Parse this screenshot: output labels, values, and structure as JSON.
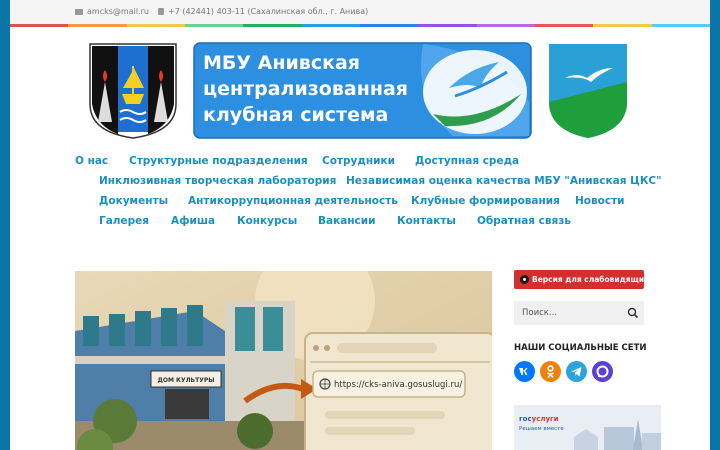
{
  "topbar": {
    "email": "amcks@mail.ru",
    "phone_address": "+7 (42441) 403-11 (Сахалинская обл., г. Анива)"
  },
  "stripe_colors": [
    "#e0514a",
    "#f2994a",
    "#f2c94c",
    "#6fcf97",
    "#27ae60",
    "#2d9cdb",
    "#2f80ed",
    "#9b51e0",
    "#bb6bd9",
    "#eb5757",
    "#f2c94c",
    "#56ccf2"
  ],
  "banner": {
    "line1": "МБУ Анивская",
    "line2": "централизованная",
    "line3": "клубная система"
  },
  "nav": {
    "row1": [
      "О нас",
      "Структурные подразделения",
      "Сотрудники",
      "Доступная среда"
    ],
    "row2": [
      "Инклюзивная творческая лаборатория",
      "Независимая оценка качества МБУ \"Анивская ЦКС\""
    ],
    "row3": [
      "Документы",
      "Антикоррупционная деятельность",
      "Клубные формирования",
      "Новости"
    ],
    "row4": [
      "Галерея",
      "Афиша",
      "Конкурсы",
      "Вакансии",
      "Контакты",
      "Обратная связь"
    ]
  },
  "hero": {
    "building_sign": "ДОМ КУЛЬТУРЫ",
    "url": "https://cks-aniva.gosuslugi.ru/"
  },
  "sidebar": {
    "accessibility_label": "Версия для слабовидящих",
    "search_placeholder": "Поиск...",
    "social_title": "НАШИ СОЦИАЛЬНЫЕ СЕТИ",
    "social": [
      {
        "name": "vk-icon",
        "color": "#0077ff"
      },
      {
        "name": "odnoklassniki-icon",
        "color": "#ee8208"
      },
      {
        "name": "telegram-icon",
        "color": "#2aa3df"
      },
      {
        "name": "max-messenger-icon",
        "color": "#5b3fd8"
      }
    ],
    "gosuslugi": {
      "brand_a": "гос",
      "brand_b": "услуги",
      "tagline": "Решаем вместе"
    }
  }
}
